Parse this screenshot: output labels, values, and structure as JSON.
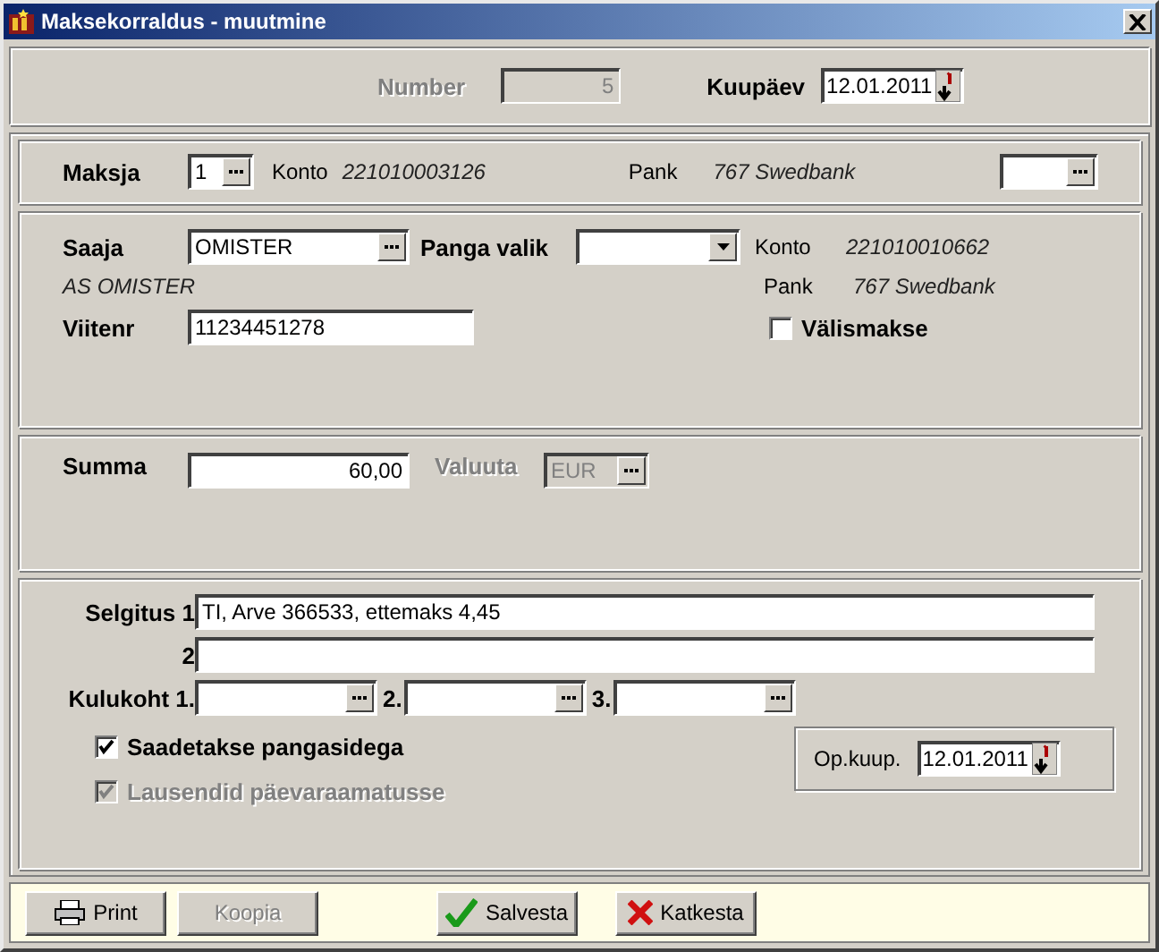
{
  "window": {
    "title": "Maksekorraldus - muutmine"
  },
  "header": {
    "number": {
      "label": "Number",
      "value": "5",
      "disabled": true
    },
    "date": {
      "label": "Kuupäev",
      "value": "12.01.2011"
    }
  },
  "payer": {
    "label": "Maksja",
    "value": "1",
    "account_label": "Konto",
    "account": "221010003126",
    "bank_label": "Pank",
    "bank": "767 Swedbank"
  },
  "recipient": {
    "label": "Saaja",
    "value": "OMISTER",
    "bank_choice_label": "Panga valik",
    "account_label": "Konto",
    "account": "221010010662",
    "name": "AS OMISTER",
    "bank_label": "Pank",
    "bank": "767 Swedbank",
    "reference_label": "Viitenr",
    "reference": "11234451278",
    "foreign": {
      "label": "Välismakse",
      "checked": false,
      "disabled": false
    }
  },
  "amount": {
    "label": "Summa",
    "value": "60,00",
    "currency_label": "Valuuta",
    "currency": "EUR",
    "currency_disabled": true
  },
  "details": {
    "line_labels": [
      "Selgitus 1",
      "2"
    ],
    "lines": [
      "TI, Arve 366533, ettemaks 4,45"
    ],
    "cost_center_labels": [
      "Kulukoht 1.",
      "2.",
      "3."
    ],
    "options": [
      {
        "label": "Saadetakse pangasidega",
        "checked": true,
        "disabled": false
      },
      {
        "label": "Lausendid päevaraamatusse",
        "checked": true,
        "disabled": true
      }
    ],
    "op_date": {
      "label": "Op.kuup.",
      "value": "12.01.2011"
    }
  },
  "buttons": [
    {
      "label": "Print",
      "kind": "printer",
      "disabled": false
    },
    {
      "label": "Koopia",
      "kind": "plain",
      "disabled": true
    },
    {
      "label": "Salvesta",
      "kind": "check",
      "disabled": false
    },
    {
      "label": "Katkesta",
      "kind": "cross",
      "disabled": false
    }
  ]
}
